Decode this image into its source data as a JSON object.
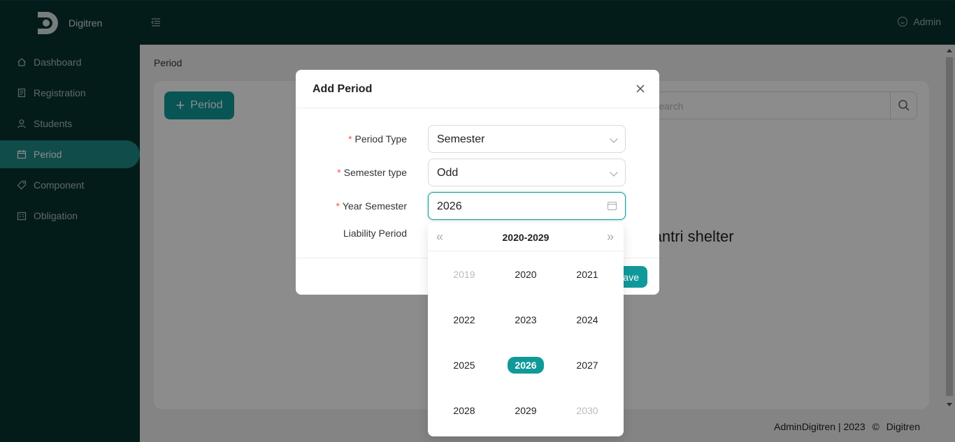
{
  "app": {
    "name": "Digitren"
  },
  "sidebar": {
    "items": [
      {
        "label": "Dashboard",
        "icon": "home-icon",
        "active": false
      },
      {
        "label": "Registration",
        "icon": "form-icon",
        "active": false
      },
      {
        "label": "Students",
        "icon": "user-icon",
        "active": false
      },
      {
        "label": "Period",
        "icon": "calendar-icon",
        "active": true
      },
      {
        "label": "Component",
        "icon": "tag-icon",
        "active": false
      },
      {
        "label": "Obligation",
        "icon": "building-icon",
        "active": false
      }
    ]
  },
  "header": {
    "user": "Admin"
  },
  "breadcrumb": "Period",
  "toolbar": {
    "add_label": "Period",
    "search_placeholder": "Search"
  },
  "empty_message": "Santri shelter",
  "footer": {
    "left": "AdminDigitren | ",
    "year": "2023",
    "copyright": "©",
    "brand": "Digitren"
  },
  "modal": {
    "title": "Add Period",
    "fields": {
      "period_type": {
        "label": "Period Type",
        "value": "Semester",
        "required": true
      },
      "semester_type": {
        "label": "Semester type",
        "value": "Odd",
        "required": true
      },
      "year_semester": {
        "label": "Year Semester",
        "value": "2026",
        "required": true
      },
      "liability_period": {
        "label": "Liability Period",
        "required": false
      }
    },
    "save_label": "ave"
  },
  "year_picker": {
    "decade": "2020-2029",
    "prev": "«",
    "next": "»",
    "years": [
      {
        "label": "2019",
        "muted": true
      },
      {
        "label": "2020"
      },
      {
        "label": "2021"
      },
      {
        "label": "2022"
      },
      {
        "label": "2023"
      },
      {
        "label": "2024"
      },
      {
        "label": "2025"
      },
      {
        "label": "2026",
        "selected": true
      },
      {
        "label": "2027"
      },
      {
        "label": "2028"
      },
      {
        "label": "2029"
      },
      {
        "label": "2030",
        "muted": true
      }
    ]
  },
  "colors": {
    "primary": "#11999a",
    "sidebar": "#063331",
    "required": "#ff4d4f"
  }
}
